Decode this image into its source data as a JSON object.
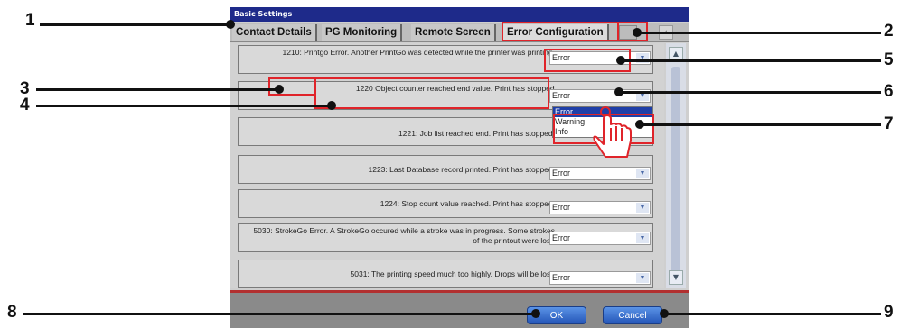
{
  "window": {
    "title": "Basic Settings",
    "tabs": [
      "Contact Details",
      "PG Monitoring",
      "Remote Screen",
      "Error Configuration"
    ]
  },
  "rows": [
    {
      "text": "1210: Printgo Error. Another PrintGo was detected while the printer was printing.",
      "severity": "Error"
    },
    {
      "code": "1220",
      "text": "Object counter reached end value. Print has stopped.",
      "severity": "Error"
    },
    {
      "text": "1221: Job list reached end. Print has stopped.",
      "severity": "Error"
    },
    {
      "text": "1223: Last Database record printed. Print has stopped.",
      "severity": "Error"
    },
    {
      "text": "1224: Stop count value reached. Print has stopped.",
      "severity": "Error"
    },
    {
      "text": "5030: StrokeGo Error. A StrokeGo occured while a stroke was in progress. Some strokes of the printout were lost.",
      "severity": "Error"
    },
    {
      "text": "5031: The printing speed much too highly. Drops will be lost.",
      "severity": "Error"
    }
  ],
  "dropdown_options": [
    "Error",
    "Warning",
    "Info"
  ],
  "buttons": {
    "ok": "OK",
    "cancel": "Cancel"
  },
  "callouts": [
    "1",
    "2",
    "3",
    "4",
    "5",
    "6",
    "7",
    "8",
    "9"
  ],
  "colors": {
    "titlebar": "#1e2a8a",
    "highlight": "#e0242a",
    "button": "#2456b8"
  }
}
